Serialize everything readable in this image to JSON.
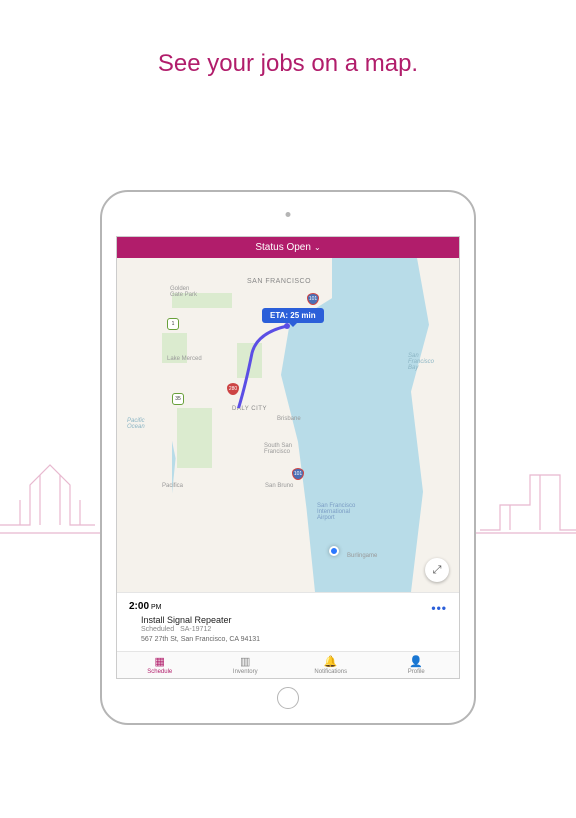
{
  "headline": "See your jobs on a map.",
  "statusBar": {
    "label": "Status Open"
  },
  "map": {
    "eta": "ETA: 25 min",
    "city": "SAN FRANCISCO",
    "places": {
      "golden": "Golden\nGate Park",
      "lake": "Lake Merced",
      "daly": "DALY CITY",
      "ssf": "South San\nFrancisco",
      "brisbane": "Brisbane",
      "sanbruno": "San Bruno",
      "pacifica": "Pacifica",
      "burlingame": "Burlingame",
      "sfo": "San Francisco\nInternational\nAirport"
    },
    "water": {
      "pacific": "Pacific\nOcean",
      "sfbay": "San\nFrancisco\nBay"
    },
    "shields": {
      "one": "1",
      "us101a": "101",
      "us101b": "101",
      "i280": "280",
      "ca35": "35"
    }
  },
  "job": {
    "time": "2:00",
    "ampm": "PM",
    "title": "Install Signal Repeater",
    "status": "Scheduled",
    "id": "SA-19712",
    "address": "567 27th St, San Francisco, CA 94131",
    "more": "•••"
  },
  "tabs": {
    "schedule": "Schedule",
    "inventory": "Inventory",
    "notifications": "Notifications",
    "profile": "Profile"
  }
}
